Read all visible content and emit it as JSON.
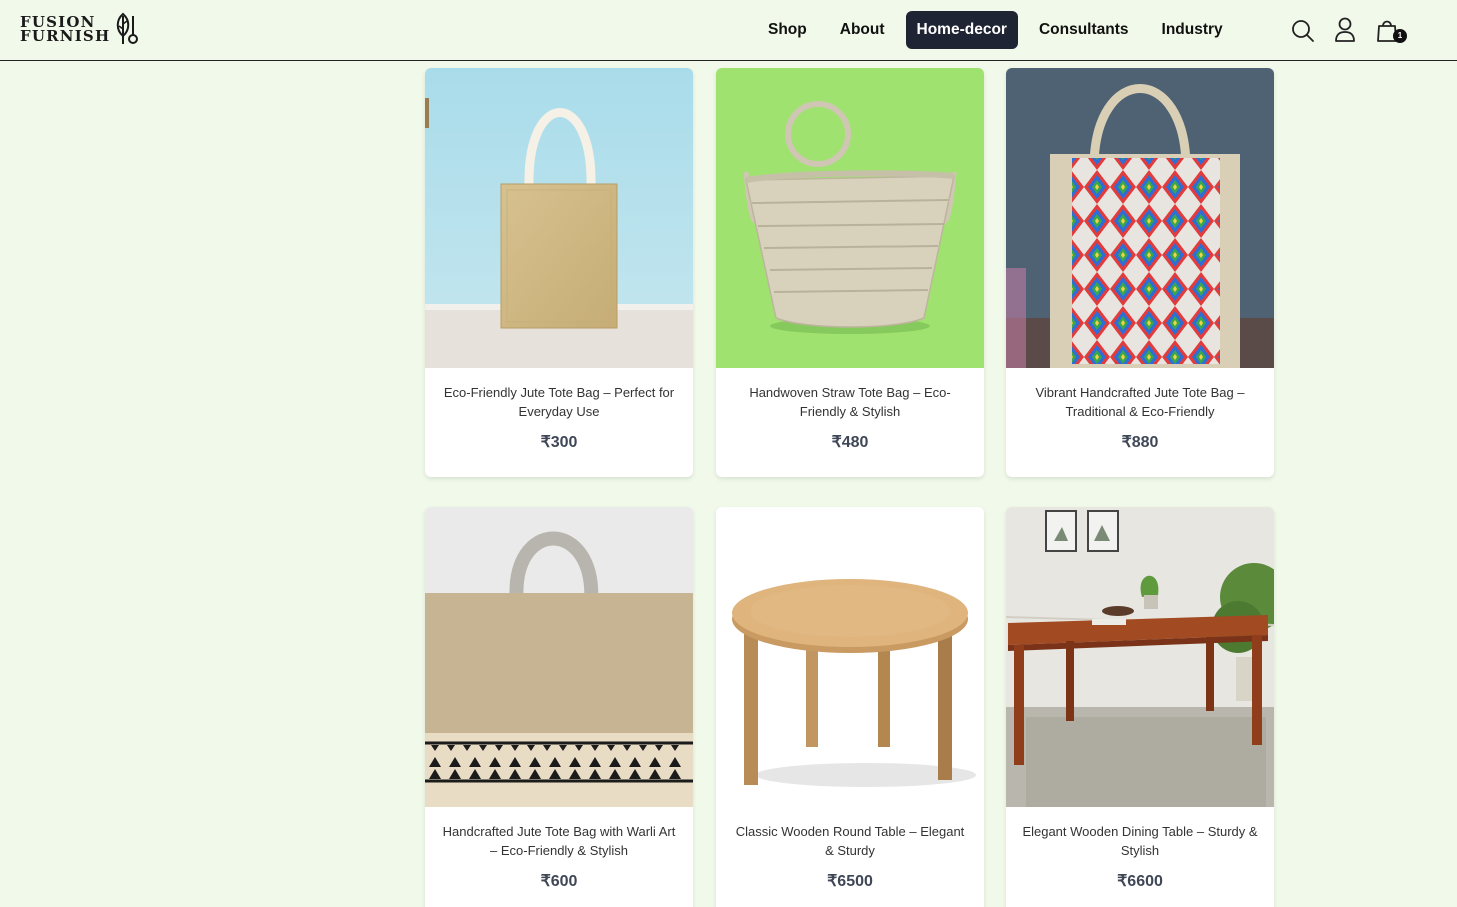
{
  "brand": {
    "line1": "FUSION",
    "line2": "FURNISH"
  },
  "nav": {
    "items": [
      {
        "label": "Shop",
        "active": false
      },
      {
        "label": "About",
        "active": false
      },
      {
        "label": "Home-decor",
        "active": true
      },
      {
        "label": "Consultants",
        "active": false
      },
      {
        "label": "Industry",
        "active": false
      }
    ]
  },
  "header_icons": {
    "search": "search-icon",
    "account": "user-icon",
    "cart": "shopping-bag-icon",
    "cart_count": "1"
  },
  "products": [
    {
      "title": "Eco-Friendly Jute Tote Bag – Perfect for Everyday Use",
      "price": "₹300"
    },
    {
      "title": "Handwoven Straw Tote Bag – Eco-Friendly & Stylish",
      "price": "₹480"
    },
    {
      "title": "Vibrant Handcrafted Jute Tote Bag – Traditional & Eco-Friendly",
      "price": "₹880"
    },
    {
      "title": "Handcrafted Jute Tote Bag with Warli Art – Eco-Friendly & Stylish",
      "price": "₹600"
    },
    {
      "title": "Classic Wooden Round Table – Elegant & Sturdy",
      "price": "₹6500"
    },
    {
      "title": "Elegant Wooden Dining Table – Sturdy & Stylish",
      "price": "₹6600"
    }
  ],
  "colors": {
    "page_background": "#f1f9ea",
    "nav_active": "#1e2433",
    "price_text": "#3f4757"
  }
}
